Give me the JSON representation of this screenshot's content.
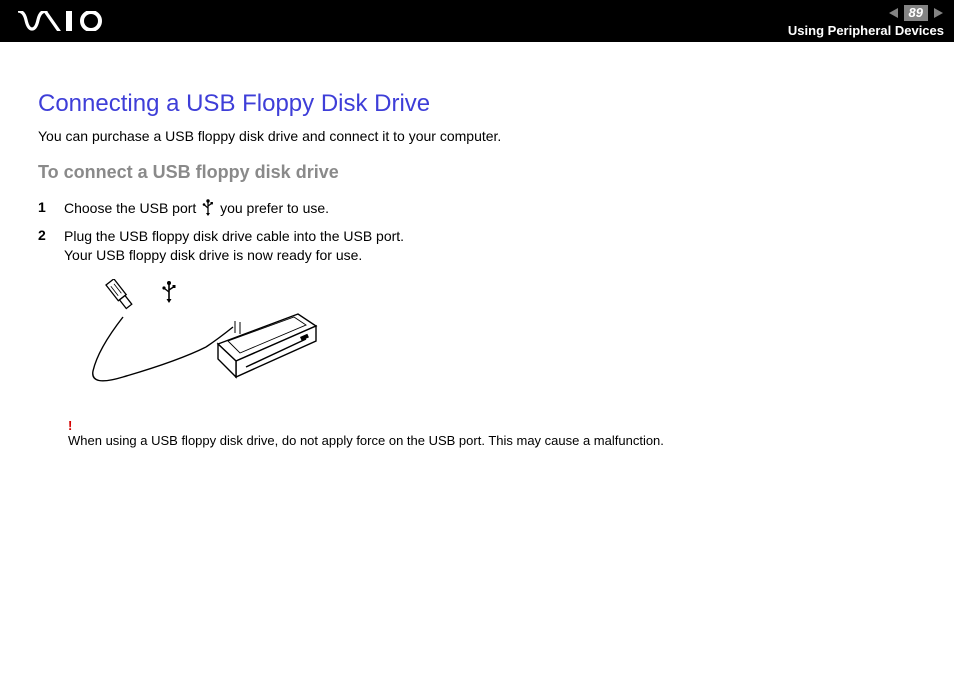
{
  "header": {
    "page_number": "89",
    "section": "Using Peripheral Devices"
  },
  "content": {
    "title": "Connecting a USB Floppy Disk Drive",
    "intro": "You can purchase a USB floppy disk drive and connect it to your computer.",
    "subtitle": "To connect a USB floppy disk drive",
    "steps": [
      {
        "num": "1",
        "text_before": "Choose the USB port ",
        "text_after": " you prefer to use."
      },
      {
        "num": "2",
        "text_before": "Plug the USB floppy disk drive cable into the USB port.\nYour USB floppy disk drive is now ready for use.",
        "text_after": ""
      }
    ],
    "warning": {
      "mark": "!",
      "text": "When using a USB floppy disk drive, do not apply force on the USB port. This may cause a malfunction."
    }
  }
}
